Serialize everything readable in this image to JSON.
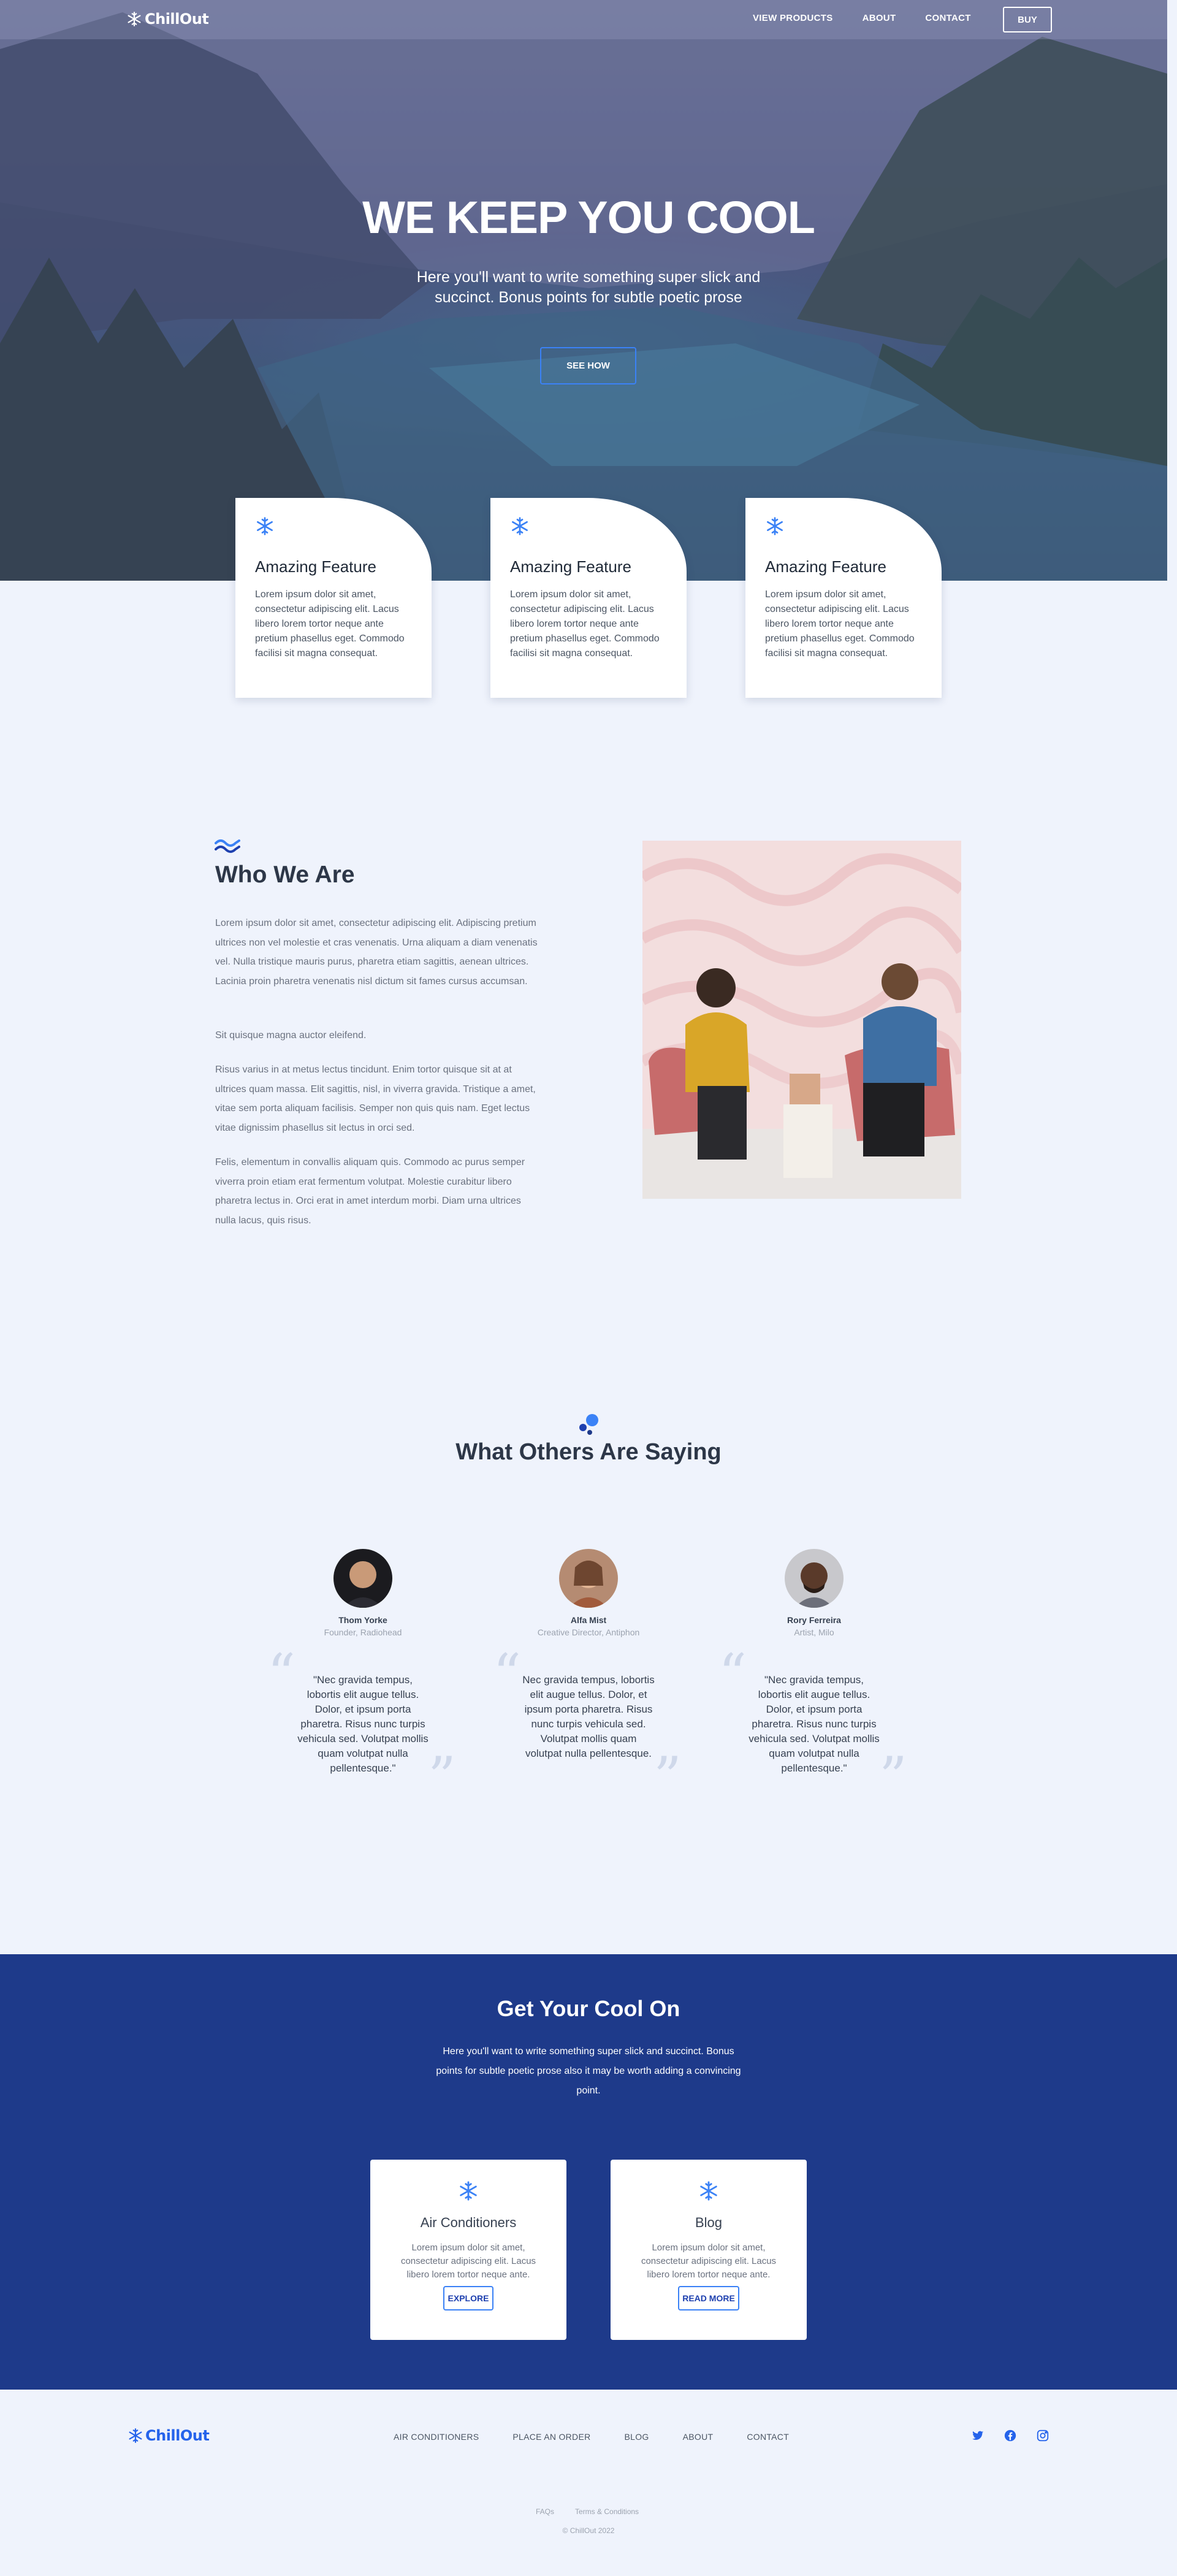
{
  "nav": {
    "logo": "ChillOut",
    "links": [
      "VIEW PRODUCTS",
      "ABOUT",
      "CONTACT"
    ],
    "buy": "BUY"
  },
  "hero": {
    "title": "WE KEEP YOU COOL",
    "subtitle": "Here you'll want to write something super slick and succinct. Bonus points for subtle poetic prose",
    "button": "SEE HOW"
  },
  "features": [
    {
      "icon": "snowflake-icon",
      "title": "Amazing Feature",
      "text": "Lorem ipsum dolor sit amet, consectetur adipiscing elit. Lacus libero lorem tortor neque ante pretium phasellus eget. Commodo facilisi sit magna consequat."
    },
    {
      "icon": "snowflake-icon",
      "title": "Amazing Feature",
      "text": "Lorem ipsum dolor sit amet, consectetur adipiscing elit. Lacus libero lorem tortor neque ante pretium phasellus eget. Commodo facilisi sit magna consequat."
    },
    {
      "icon": "snowflake-icon",
      "title": "Amazing Feature",
      "text": "Lorem ipsum dolor sit amet, consectetur adipiscing elit. Lacus libero lorem tortor neque ante pretium phasellus eget. Commodo facilisi sit magna consequat."
    }
  ],
  "who": {
    "title": "Who We Are",
    "paragraphs": [
      "Lorem ipsum dolor sit amet, consectetur adipiscing elit. Adipiscing pretium ultrices non vel molestie et cras venenatis. Urna aliquam a diam venenatis vel. Nulla tristique mauris purus, pharetra etiam sagittis, aenean ultrices. Lacinia proin pharetra venenatis nisl dictum sit fames cursus accumsan.",
      "Sit quisque magna auctor eleifend.",
      "Risus varius in at metus lectus tincidunt. Enim tortor quisque sit at at ultrices quam massa. Elit sagittis, nisl, in viverra gravida. Tristique a amet, vitae sem porta aliquam facilisis. Semper non quis quis nam. Eget lectus vitae dignissim phasellus sit lectus in orci sed.",
      "Felis, elementum in convallis aliquam quis. Commodo ac purus semper viverra proin etiam erat fermentum volutpat. Molestie curabitur libero pharetra lectus in. Orci erat in amet interdum morbi. Diam urna ultrices nulla lacus, quis risus."
    ]
  },
  "testimonials": {
    "title": "What Others Are Saying",
    "items": [
      {
        "name": "Thom Yorke",
        "role": "Founder, Radiohead",
        "quote": "\"Nec gravida tempus, lobortis elit augue tellus. Dolor, et ipsum porta pharetra. Risus nunc turpis vehicula sed. Volutpat mollis quam volutpat nulla pellentesque.\""
      },
      {
        "name": "Alfa Mist",
        "role": "Creative Director, Antiphon",
        "quote": "Nec gravida tempus, lobortis elit augue tellus. Dolor, et ipsum porta pharetra. Risus nunc turpis vehicula sed. Volutpat mollis quam volutpat nulla pellentesque."
      },
      {
        "name": "Rory Ferreira",
        "role": "Artist, Milo",
        "quote": "\"Nec gravida tempus, lobortis elit augue tellus. Dolor, et ipsum porta pharetra. Risus nunc turpis vehicula sed. Volutpat mollis quam volutpat nulla pellentesque.\""
      }
    ]
  },
  "cta": {
    "title": "Get Your Cool On",
    "text": "Here you'll want to write something super slick and succinct. Bonus points for subtle poetic prose also it may be worth adding a convincing point.",
    "cards": [
      {
        "title": "Air Conditioners",
        "text": "Lorem ipsum dolor sit amet, consectetur adipiscing elit. Lacus libero lorem tortor neque ante.",
        "button": "EXPLORE"
      },
      {
        "title": "Blog",
        "text": "Lorem ipsum dolor sit amet, consectetur adipiscing elit. Lacus libero lorem tortor neque ante.",
        "button": "READ MORE"
      }
    ]
  },
  "footer": {
    "logo": "ChillOut",
    "links": [
      "AIR CONDITIONERS",
      "PLACE AN ORDER",
      "BLOG",
      "ABOUT",
      "CONTACT"
    ],
    "social": [
      "twitter-icon",
      "facebook-icon",
      "instagram-icon"
    ],
    "small_links": [
      "FAQs",
      "Terms & Conditions"
    ],
    "copyright": "© ChillOut 2022"
  },
  "colors": {
    "accent": "#3b82f6",
    "brand_dark": "#1e3a8a",
    "page_bg": "#eff3fc"
  }
}
